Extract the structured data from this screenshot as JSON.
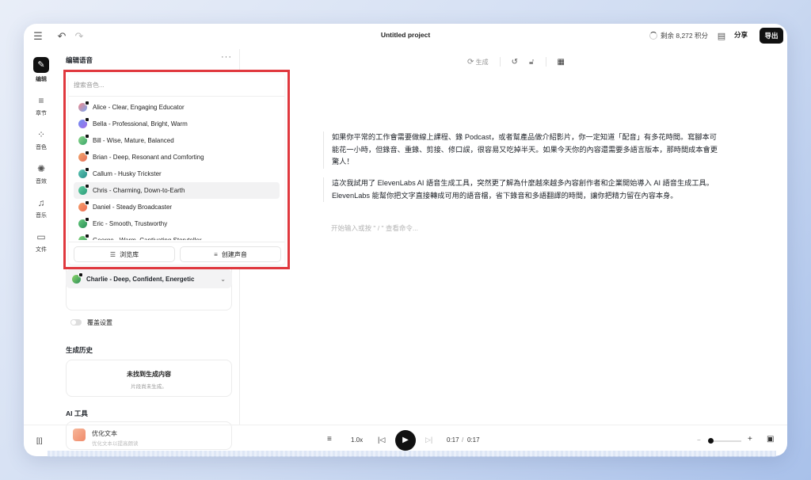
{
  "topbar": {
    "project_title": "Untitled project",
    "credits": "剩余 8,272 积分",
    "share_label": "分享",
    "export_label": "导出"
  },
  "rail": {
    "items": [
      {
        "label": "编辑",
        "icon": "edit-icon",
        "active": true
      },
      {
        "label": "章节",
        "icon": "chapters-icon"
      },
      {
        "label": "音色",
        "icon": "voices-icon"
      },
      {
        "label": "音效",
        "icon": "sound-effects-icon"
      },
      {
        "label": "音乐",
        "icon": "music-icon"
      },
      {
        "label": "文件",
        "icon": "files-icon"
      }
    ]
  },
  "panel": {
    "title": "编辑语音",
    "search_placeholder": "搜索音色...",
    "voices": [
      {
        "name": "Alice - Clear, Engaging Educator",
        "colors": [
          "#f28a8a",
          "#7aa7f0"
        ]
      },
      {
        "name": "Bella - Professional, Bright, Warm",
        "colors": [
          "#6f8ff2",
          "#a36de8"
        ]
      },
      {
        "name": "Bill - Wise, Mature, Balanced",
        "colors": [
          "#8cd68a",
          "#3aa66b"
        ]
      },
      {
        "name": "Brian - Deep, Resonant and Comforting",
        "colors": [
          "#f2a76b",
          "#e66f5b"
        ]
      },
      {
        "name": "Callum - Husky Trickster",
        "colors": [
          "#5cc6b3",
          "#2b8f8a"
        ]
      },
      {
        "name": "Chris - Charming, Down-to-Earth",
        "colors": [
          "#5ed0a0",
          "#2c9a7a"
        ]
      },
      {
        "name": "Daniel - Steady Broadcaster",
        "colors": [
          "#f5a06b",
          "#ee6d55"
        ]
      },
      {
        "name": "Eric - Smooth, Trustworthy",
        "colors": [
          "#63c97a",
          "#2c8f59"
        ]
      },
      {
        "name": "George - Warm, Captivating Storyteller",
        "colors": [
          "#7fd17a",
          "#3aa365"
        ]
      }
    ],
    "browse_label": "浏览库",
    "create_label": "创建声音",
    "selected_voice": "Charlie - Deep, Confident, Energetic",
    "override_label": "覆盖设置",
    "history_title": "生成历史",
    "history_empty": "未找到生成内容",
    "history_empty_sub": "片段尚未生成。",
    "ai_tools_title": "AI 工具",
    "ai_tool_name": "优化文本",
    "ai_tool_sub": "优化文本以提高朗读"
  },
  "editor": {
    "generate_label": "生成",
    "paragraph_1": "如果你平常的工作會需要做線上課程、錄 Podcast，或者幫產品做介紹影片，你一定知道「配音」有多花時間。寫腳本可能花一小時，但錄音、重錄、剪接、修口誤，很容易又吃掉半天。如果今天你的內容還需要多語言版本，那時間成本會更驚人！",
    "paragraph_2": "這次我試用了 ElevenLabs AI 語音生成工具，突然更了解為什麼越來越多內容創作者和企業開始導入 AI 語音生成工具。ElevenLabs 能幫你把文字直接轉成可用的語音檔，省下錄音和多語翻譯的時間，讓你把精力留在內容本身。",
    "placeholder": "开始输入或按 \" / \" 查看命令..."
  },
  "player": {
    "speed": "1.0x",
    "time_current": "0:17",
    "time_separator": "/",
    "time_total": "0:17"
  }
}
